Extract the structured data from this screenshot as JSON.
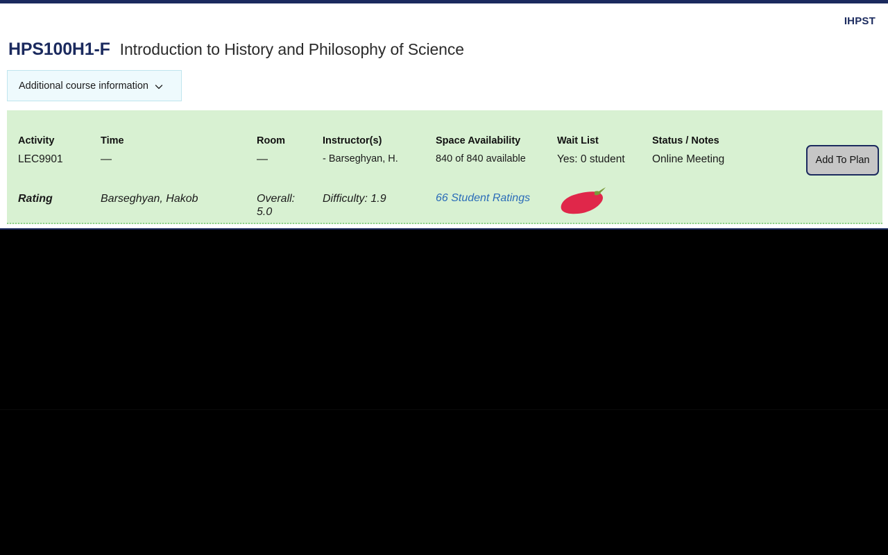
{
  "header": {
    "org_code": "IHPST"
  },
  "course": {
    "code": "HPS100H1-F",
    "name": "Introduction to History and Philosophy of Science"
  },
  "disclosure": {
    "label": "Additional course information",
    "icon": "chevron-down-icon"
  },
  "meeting_table": {
    "columns": [
      "Activity",
      "Time",
      "Room",
      "Instructor(s)",
      "Space Availability",
      "Wait List",
      "Status / Notes"
    ],
    "meeting_row": {
      "activity": "LEC9901",
      "time": "—",
      "room": "—",
      "instructor": "- Barseghyan, H.",
      "space_availability": "840 of 840 available",
      "wait_list": "Yes: 0 student",
      "status_notes": "Online Meeting"
    },
    "rating_row": {
      "label": "Rating",
      "instructor_name": "Barseghyan, Hakob",
      "overall": "Overall: 5.0",
      "difficulty": "Difficulty: 1.9",
      "student_ratings_link": "66 Student Ratings",
      "chili_icon": "chili-pepper-icon"
    },
    "add_to_plan_label": "Add To Plan"
  },
  "colors": {
    "topbar": "#1b2a5e",
    "panel_background": "#d8f1d2",
    "panel_border": "#8fd08a",
    "disclosure_background": "#eefafd",
    "disclosure_border": "#bfe5ee",
    "course_code": "#1b2a5e",
    "link": "#2b6cb8",
    "button_face": "#c6c6c6",
    "button_border": "#1b2a5e",
    "chili_red": "#e0274a",
    "chili_stem": "#7a9a3a"
  }
}
